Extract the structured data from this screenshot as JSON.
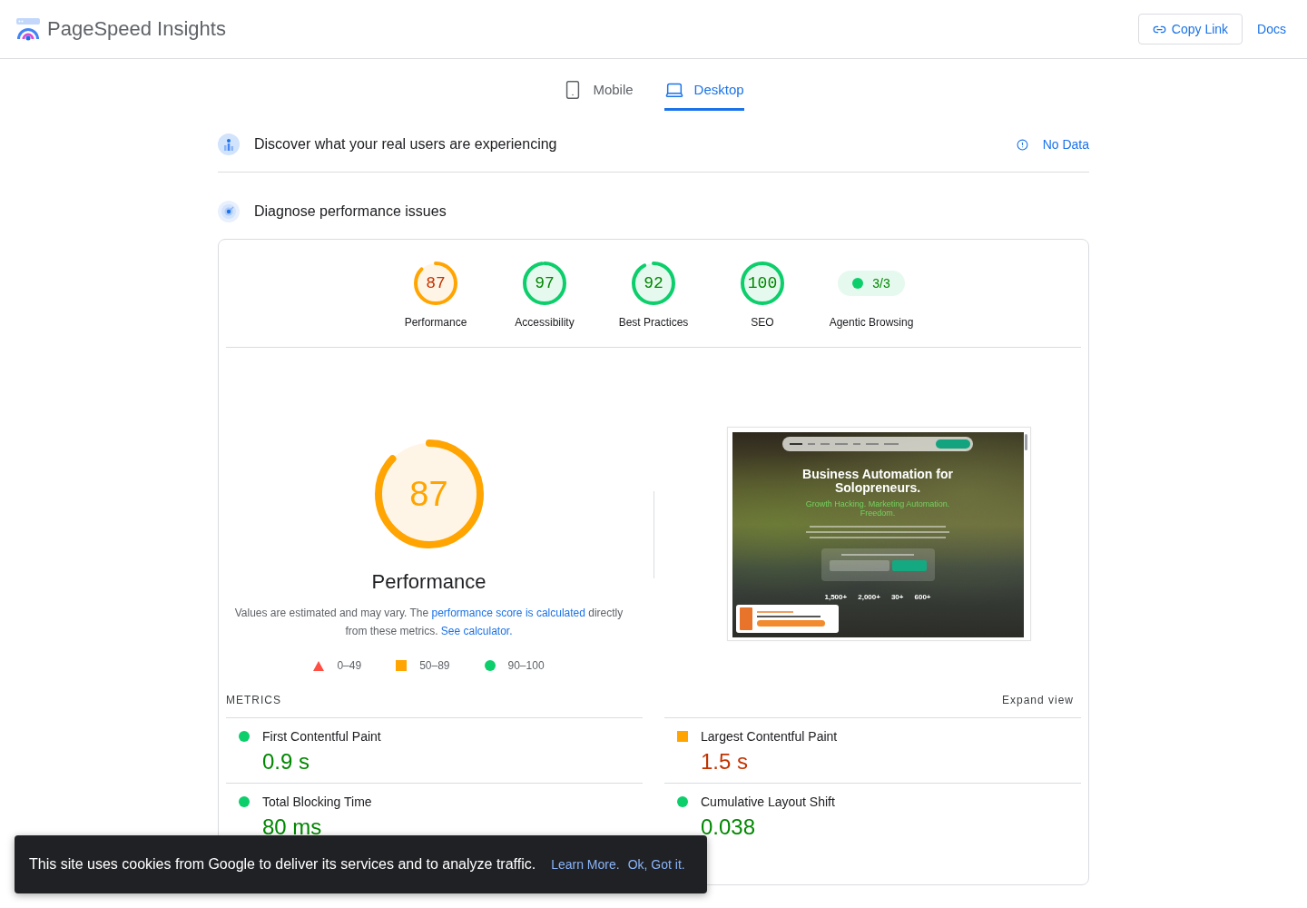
{
  "header": {
    "title": "PageSpeed Insights",
    "actions": [
      {
        "kind": "outlined",
        "label": "Copy Link"
      },
      {
        "kind": "text",
        "label": "Docs"
      }
    ]
  },
  "device_tabs": [
    {
      "kind": "phone",
      "label": "Mobile",
      "selected": false
    },
    {
      "kind": "laptop",
      "label": "Desktop",
      "selected": true
    }
  ],
  "field_data": {
    "title": "Discover what your real users are experiencing",
    "status": "No Data"
  },
  "lab_data": {
    "title": "Diagnose performance issues",
    "scores": [
      {
        "kind": "gauge",
        "value": "87",
        "color": "#ffa400",
        "label": "Performance"
      },
      {
        "kind": "gauge",
        "value": "97",
        "color": "#0cce6b",
        "label": "Accessibility"
      },
      {
        "kind": "gauge",
        "value": "92",
        "color": "#0cce6b",
        "label": "Best Practices"
      },
      {
        "kind": "gauge",
        "value": "100",
        "color": "#0cce6b",
        "label": "SEO"
      },
      {
        "kind": "pill",
        "value": "3/3",
        "color": "#0cce6b",
        "label": "Agentic Browsing"
      }
    ],
    "summary": {
      "value": "87",
      "color": "#ffa400",
      "title": "Performance",
      "description": [
        {
          "kind": "text",
          "text": "Values are estimated and may vary. The "
        },
        {
          "kind": "link",
          "text": "performance score is calculated"
        },
        {
          "kind": "text",
          "text": " directly from these metrics. "
        },
        {
          "kind": "link",
          "text": "See calculator."
        }
      ],
      "legend": [
        {
          "kind": "fail",
          "range": "0–49"
        },
        {
          "kind": "average",
          "range": "50–89"
        },
        {
          "kind": "pass",
          "range": "90–100"
        }
      ]
    },
    "page_screenshot": {
      "headline": "Business Automation for Solopreneurs.",
      "tagline": "Growth Hacking. Marketing Automation. Freedom.",
      "stats": [
        "1,500+",
        "2,000+",
        "30+",
        "600+"
      ]
    },
    "metrics": {
      "heading": "METRICS",
      "expand_label": "Expand view",
      "items": [
        {
          "name": "First Contentful Paint",
          "value": "0.9 s",
          "color": "#008800"
        },
        {
          "name": "Largest Contentful Paint",
          "value": "1.5 s",
          "color": "#c33300"
        },
        {
          "name": "Total Blocking Time",
          "value": "80 ms",
          "color": "#008800"
        },
        {
          "name": "Cumulative Layout Shift",
          "value": "0.038",
          "color": "#008800"
        }
      ]
    }
  },
  "cookie_banner": {
    "message": "This site uses cookies from Google to deliver its services and to analyze traffic.",
    "learn_more": "Learn More.",
    "dismiss": "Ok, Got it."
  }
}
